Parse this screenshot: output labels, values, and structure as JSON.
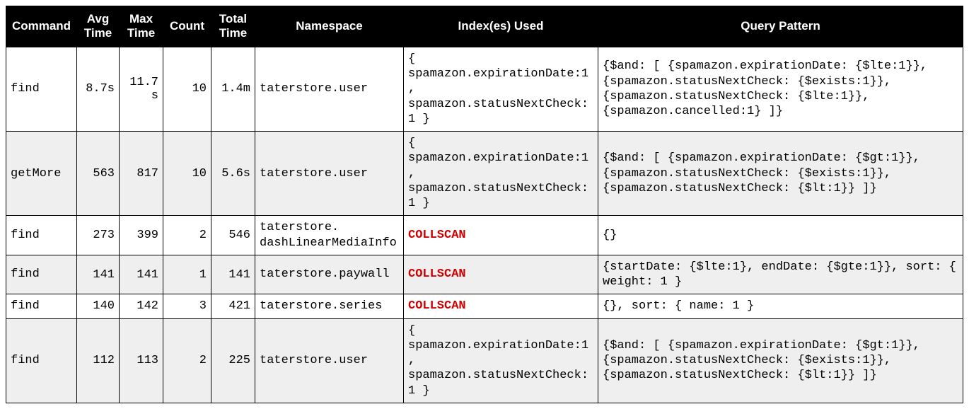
{
  "columns": {
    "command": "Command",
    "avg_time": "Avg Time",
    "max_time": "Max Time",
    "count": "Count",
    "total_time": "Total Time",
    "namespace": "Namespace",
    "indexes": "Index(es) Used",
    "query_pattern": "Query Pattern"
  },
  "rows": [
    {
      "command": "find",
      "avg_time": "8.7s",
      "max_time": "11.7s",
      "count": "10",
      "total_time": "1.4m",
      "namespace": "taterstore.user",
      "indexes": "{ spamazon.expirationDate:1, spamazon.statusNextCheck:1 }",
      "indexes_is_collscan": false,
      "query_pattern": "{$and: [ {spamazon.expirationDate: {$lte:1}}, {spamazon.statusNextCheck: {$exists:1}}, {spamazon.statusNextCheck: {$lte:1}}, {spamazon.cancelled:1} ]}"
    },
    {
      "command": "getMore",
      "avg_time": "563",
      "max_time": "817",
      "count": "10",
      "total_time": "5.6s",
      "namespace": "taterstore.user",
      "indexes": "{ spamazon.expirationDate:1, spamazon.statusNextCheck:1 }",
      "indexes_is_collscan": false,
      "query_pattern": "{$and: [ {spamazon.expirationDate: {$gt:1}}, {spamazon.statusNextCheck: {$exists:1}}, {spamazon.statusNextCheck: {$lt:1}} ]}"
    },
    {
      "command": "find",
      "avg_time": "273",
      "max_time": "399",
      "count": "2",
      "total_time": "546",
      "namespace": "taterstore. dashLinearMediaInfo",
      "indexes": "COLLSCAN",
      "indexes_is_collscan": true,
      "query_pattern": "{}"
    },
    {
      "command": "find",
      "avg_time": "141",
      "max_time": "141",
      "count": "1",
      "total_time": "141",
      "namespace": "taterstore.paywall",
      "indexes": "COLLSCAN",
      "indexes_is_collscan": true,
      "query_pattern": "{startDate: {$lte:1}, endDate: {$gte:1}}, sort: { weight: 1 }"
    },
    {
      "command": "find",
      "avg_time": "140",
      "max_time": "142",
      "count": "3",
      "total_time": "421",
      "namespace": "taterstore.series",
      "indexes": "COLLSCAN",
      "indexes_is_collscan": true,
      "query_pattern": "{}, sort: { name: 1 }"
    },
    {
      "command": "find",
      "avg_time": "112",
      "max_time": "113",
      "count": "2",
      "total_time": "225",
      "namespace": "taterstore.user",
      "indexes": "{ spamazon.expirationDate:1, spamazon.statusNextCheck:1 }",
      "indexes_is_collscan": false,
      "query_pattern": "{$and: [ {spamazon.expirationDate: {$gt:1}}, {spamazon.statusNextCheck: {$exists:1}}, {spamazon.statusNextCheck: {$lt:1}} ]}"
    }
  ]
}
